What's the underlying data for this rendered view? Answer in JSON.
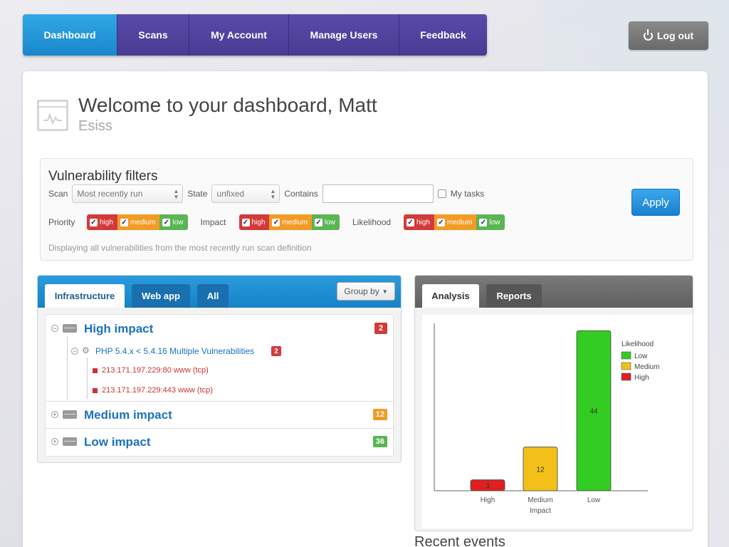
{
  "nav": {
    "items": [
      {
        "label": "Dashboard",
        "active": true
      },
      {
        "label": "Scans",
        "active": false
      },
      {
        "label": "My Account",
        "active": false
      },
      {
        "label": "Manage Users",
        "active": false
      },
      {
        "label": "Feedback",
        "active": false
      }
    ],
    "logout_label": "Log out"
  },
  "header": {
    "title": "Welcome to your dashboard, Matt",
    "subtitle": "Esiss"
  },
  "filters": {
    "title": "Vulnerability filters",
    "scan_label": "Scan",
    "scan_value": "Most recently run",
    "state_label": "State",
    "state_value": "unfixed",
    "contains_label": "Contains",
    "contains_value": "",
    "my_tasks_label": "My tasks",
    "my_tasks_checked": false,
    "priority_label": "Priority",
    "impact_label": "Impact",
    "likelihood_label": "Likelihood",
    "levels": [
      "high",
      "medium",
      "low"
    ],
    "note": "Displaying all vulnerabilities from the most recently run scan definition",
    "apply_label": "Apply"
  },
  "left_card": {
    "tabs": [
      "Infrastructure",
      "Web app",
      "All"
    ],
    "active_tab": "Infrastructure",
    "groupby_label": "Group by",
    "groups": {
      "high": {
        "title": "High impact",
        "count": "2"
      },
      "medium": {
        "title": "Medium impact",
        "count": "12"
      },
      "low": {
        "title": "Low impact",
        "count": "36"
      }
    },
    "vulnerability": {
      "title": "PHP 5.4.x < 5.4.16 Multiple Vulnerabilities",
      "count": "2"
    },
    "hosts": [
      "213.171.197.229:80 www (tcp)",
      "213.171.197.229:443 www (tcp)"
    ]
  },
  "right_card": {
    "tabs": [
      "Analysis",
      "Reports"
    ],
    "active_tab": "Analysis"
  },
  "recent_events_title": "Recent events",
  "colors": {
    "nav_active": "#1a86cc",
    "nav": "#4a3b94",
    "high": "#d33a3a",
    "medium": "#f29b25",
    "low": "#5ab553",
    "link": "#1b72c0"
  },
  "chart_data": {
    "type": "bar",
    "categories": [
      "High",
      "Medium",
      "Low"
    ],
    "values": [
      3,
      12,
      44
    ],
    "bar_colors": [
      "#e02020",
      "#f2c018",
      "#33cc22"
    ],
    "xlabel": "Impact",
    "legend_title": "Likelihood",
    "legend": [
      {
        "name": "Low",
        "color": "#33cc22"
      },
      {
        "name": "Medium",
        "color": "#f2c018"
      },
      {
        "name": "High",
        "color": "#e02020"
      }
    ],
    "ylim": [
      0,
      46
    ]
  }
}
